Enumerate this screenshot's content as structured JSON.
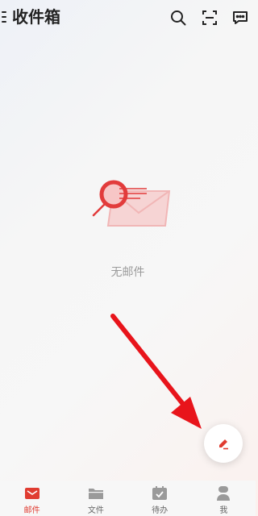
{
  "header": {
    "title": "收件箱",
    "icons": [
      "menu-icon",
      "search-icon",
      "scan-icon",
      "message-icon"
    ]
  },
  "empty_state": {
    "text": "无邮件",
    "illustration": "empty-mail-icon"
  },
  "fab": {
    "icon": "compose-icon"
  },
  "tabs": [
    {
      "label": "邮件",
      "icon": "mail-icon",
      "active": true
    },
    {
      "label": "文件",
      "icon": "folder-icon",
      "active": false
    },
    {
      "label": "待办",
      "icon": "todo-calendar-icon",
      "active": false
    },
    {
      "label": "我",
      "icon": "profile-icon",
      "active": false
    }
  ],
  "colors": {
    "accent": "#e03c31",
    "inactive": "#9a9a9a",
    "annotation_arrow": "#e8141b"
  }
}
